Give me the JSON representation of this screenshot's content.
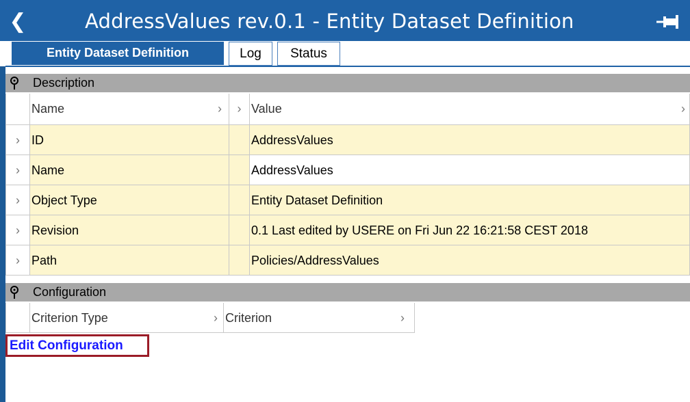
{
  "window": {
    "title": "AddressValues rev.0.1 - Entity Dataset Definition",
    "back_icon": "chevron-left-icon",
    "pin_icon": "pin-icon",
    "accent_color": "#1f62a6"
  },
  "tabs": [
    {
      "label": "Entity Dataset Definition",
      "active": true
    },
    {
      "label": "Log",
      "active": false
    },
    {
      "label": "Status",
      "active": false
    }
  ],
  "description": {
    "section_label": "Description",
    "columns": {
      "name": "Name",
      "value": "Value"
    },
    "rows": [
      {
        "name": "ID",
        "value": "AddressValues"
      },
      {
        "name": "Name",
        "value": "AddressValues"
      },
      {
        "name": "Object Type",
        "value": "Entity Dataset Definition"
      },
      {
        "name": "Revision",
        "value": "0.1 Last edited by USERE on Fri Jun 22 16:21:58 CEST 2018"
      },
      {
        "name": "Path",
        "value": "Policies/AddressValues"
      }
    ]
  },
  "configuration": {
    "section_label": "Configuration",
    "columns": {
      "criterion_type": "Criterion Type",
      "criterion": "Criterion"
    },
    "edit_link": "Edit Configuration"
  }
}
